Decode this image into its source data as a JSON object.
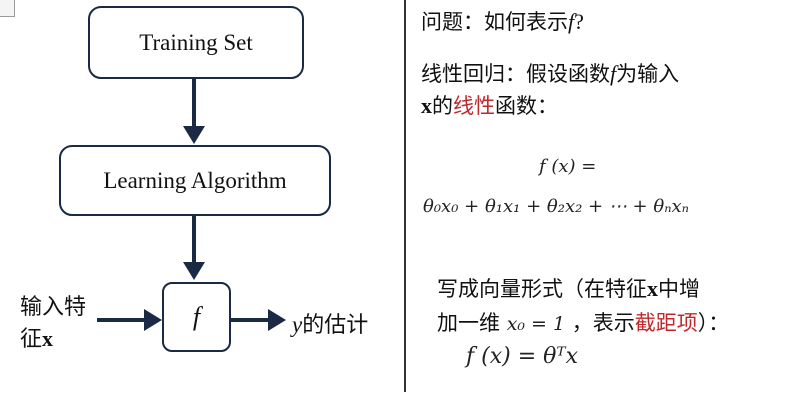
{
  "flow": {
    "training_set": "Training Set",
    "learning_algorithm": "Learning Algorithm",
    "f_box": "f",
    "input_label_line1": "输入特",
    "input_label_line2": "征",
    "input_label_bold": "x",
    "output_label_var": "y",
    "output_label_text": "的估计"
  },
  "right": {
    "question_text": "问题：如何表示",
    "question_var": "f",
    "question_mark": "?",
    "lr_line1_a": "线性回归：假设函数",
    "lr_line1_var": "f",
    "lr_line1_b": "为输入",
    "lr_line2_bold": "x",
    "lr_line2_a": "的",
    "lr_line2_red": "线性",
    "lr_line2_b": "函数：",
    "formula_lhs": "f (x) =",
    "formula_rhs": "θ₀x₀ + θ₁x₁ + θ₂x₂ + ⋯ + θₙxₙ",
    "vec_line1_a": "写成向量形式（在特征",
    "vec_line1_bold": "x",
    "vec_line1_b": "中增",
    "vec_line2_a": "加一维",
    "vec_line2_math": "x₀ = 1",
    "vec_line2_b": "，表示",
    "vec_line2_red": "截距项",
    "vec_line2_c": "）：",
    "vec_formula": "f (x) = θᵀx"
  },
  "colors": {
    "arrow": "#1a2a44",
    "highlight": "#c0282b"
  }
}
